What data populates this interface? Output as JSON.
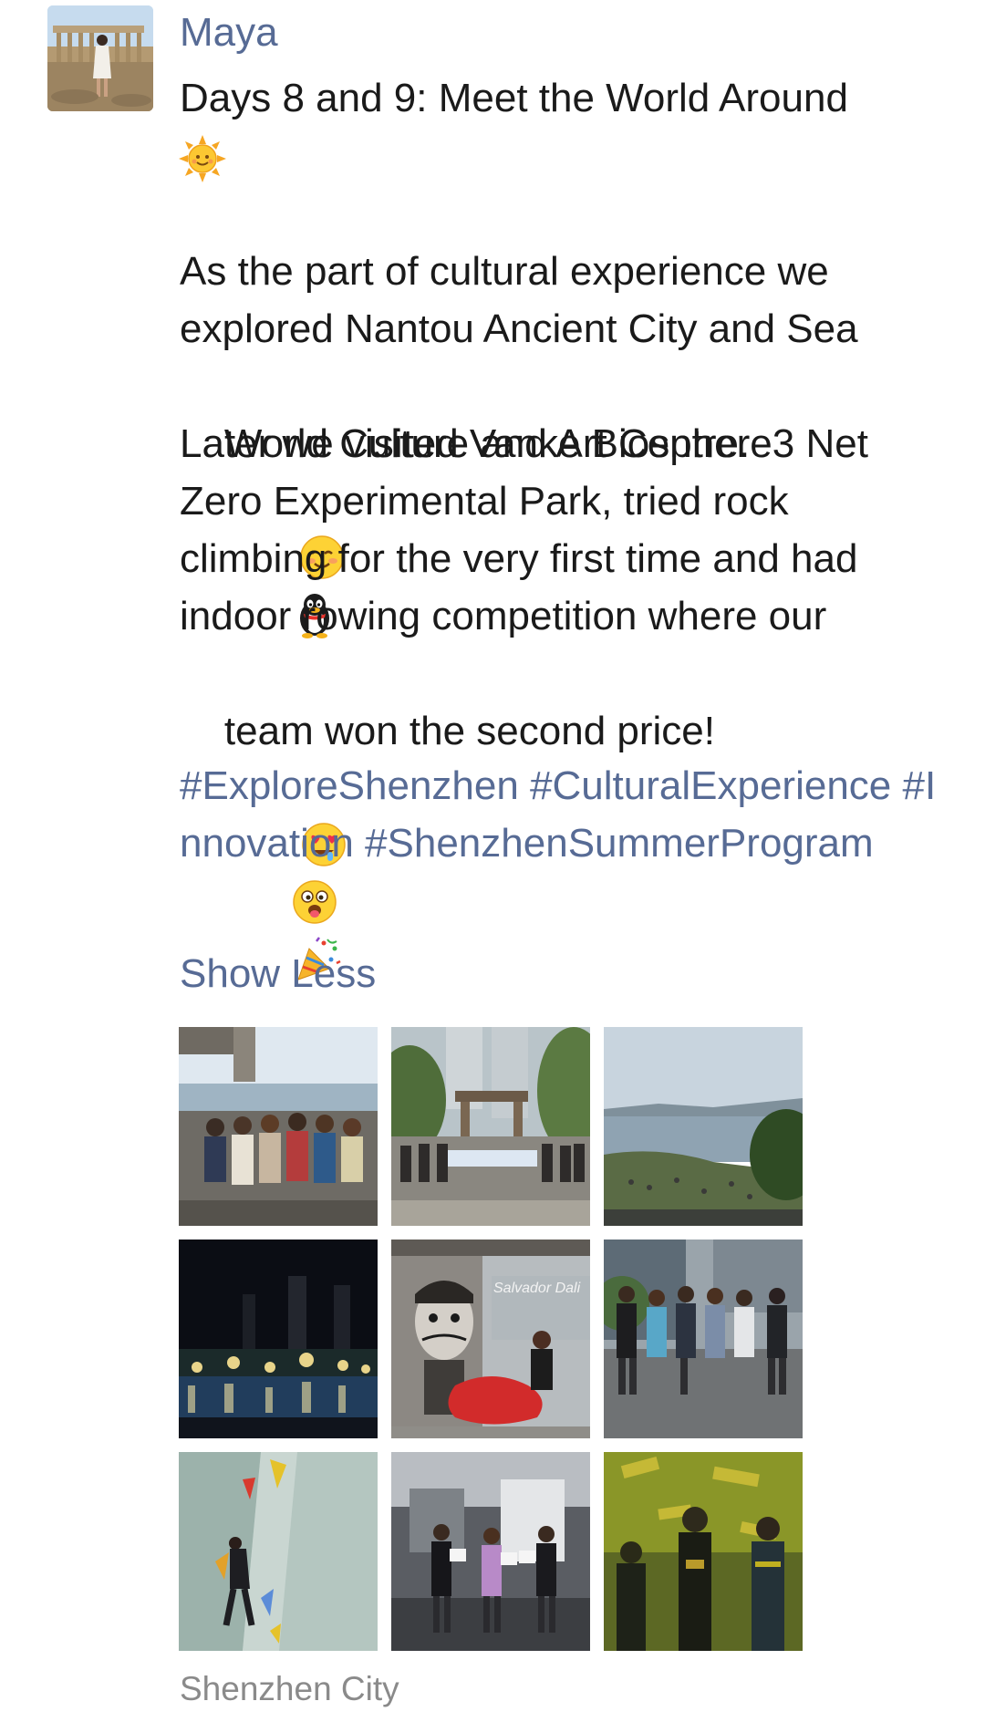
{
  "post": {
    "author": "Maya",
    "title_line": "Days 8 and 9: Meet the World Around",
    "body_lines": [
      "As the part of cultural experience we",
      "explored Nantou Ancient City and Sea",
      "World Culture and Art Centre.",
      "Later we visited Vanke Biosphere3 Net",
      "Zero Experimental Park, tried rock",
      "climbing for the very first time and had",
      "indoor rowing competition where our",
      "team won the second price!"
    ],
    "hashtags": "#ExploreShenzhen #CulturalExperience #Innovation #ShenzhenSummerProgram",
    "show_less_label": "Show Less",
    "location": "Shenzhen City",
    "photo_sign_text": "Salvador Dali"
  },
  "icons": {
    "sun": "sun-emoji-icon",
    "blush": "blush-emoji-icon",
    "penguin": "qq-penguin-icon",
    "heart_eyes": "heart-eyes-emoji-icon",
    "tongue": "tongue-wink-emoji-icon",
    "party": "party-popper-icon"
  },
  "colors": {
    "link": "#576b95",
    "text": "#1a1a1a",
    "muted": "#8a8a8a"
  }
}
